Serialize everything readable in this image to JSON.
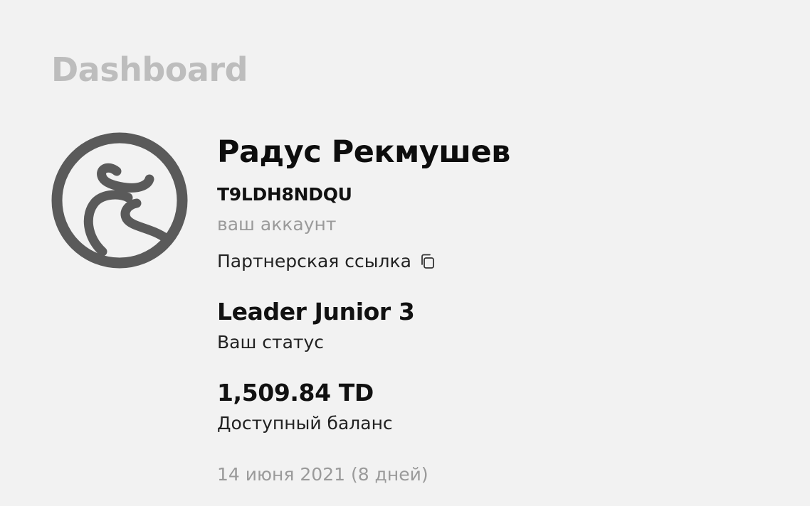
{
  "header": {
    "title": "Dashboard"
  },
  "profile": {
    "avatar_icon": "bull-logo-icon",
    "name": "Радус Рекмушев",
    "account_id": "T9LDH8NDQU",
    "account_caption": "ваш аккаунт",
    "partner_link_label": "Партнерская ссылка",
    "partner_link_icon": "copy-icon"
  },
  "status": {
    "value": "Leader Junior 3",
    "caption": "Ваш статус"
  },
  "balance": {
    "value": "1,509.84 TD",
    "caption": "Доступный баланс"
  },
  "registration": {
    "date_text": "14 июня 2021 (8 дней)"
  },
  "colors": {
    "background": "#f2f2f2",
    "title_muted": "#bdbdbd",
    "logo": "#5a5a5a",
    "text_primary": "#111111",
    "text_muted": "#9a9a9a"
  }
}
